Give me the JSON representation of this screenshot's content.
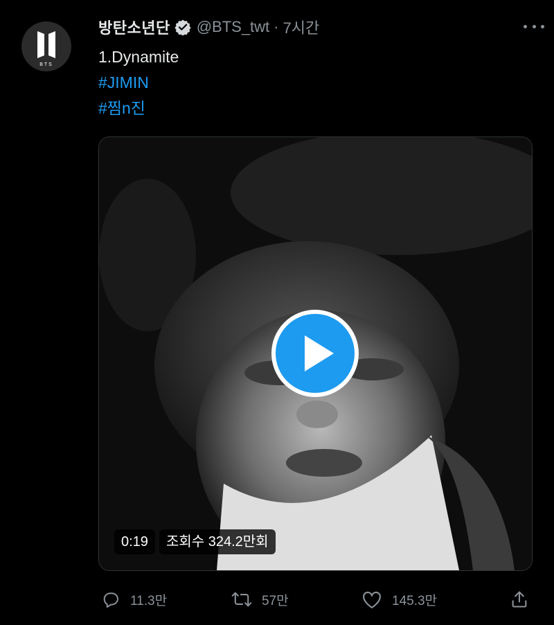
{
  "tweet": {
    "author_name": "방탄소년단",
    "handle": "@BTS_twt",
    "separator": "·",
    "time": "7시간",
    "lines": [
      "1.Dynamite",
      "#JIMIN",
      "#찜n진"
    ],
    "avatar_logo_text": "BTS"
  },
  "video": {
    "duration": "0:19",
    "views": "조회수 324.2만회"
  },
  "actions": {
    "reply_count": "11.3만",
    "retweet_count": "57만",
    "like_count": "145.3만"
  },
  "colors": {
    "background": "#000000",
    "accent": "#1d9bf0",
    "muted": "#8b9299"
  },
  "icons": [
    "bts-logo-icon",
    "verified-badge-icon",
    "more-icon",
    "play-icon",
    "reply-icon",
    "retweet-icon",
    "like-icon",
    "share-icon"
  ]
}
